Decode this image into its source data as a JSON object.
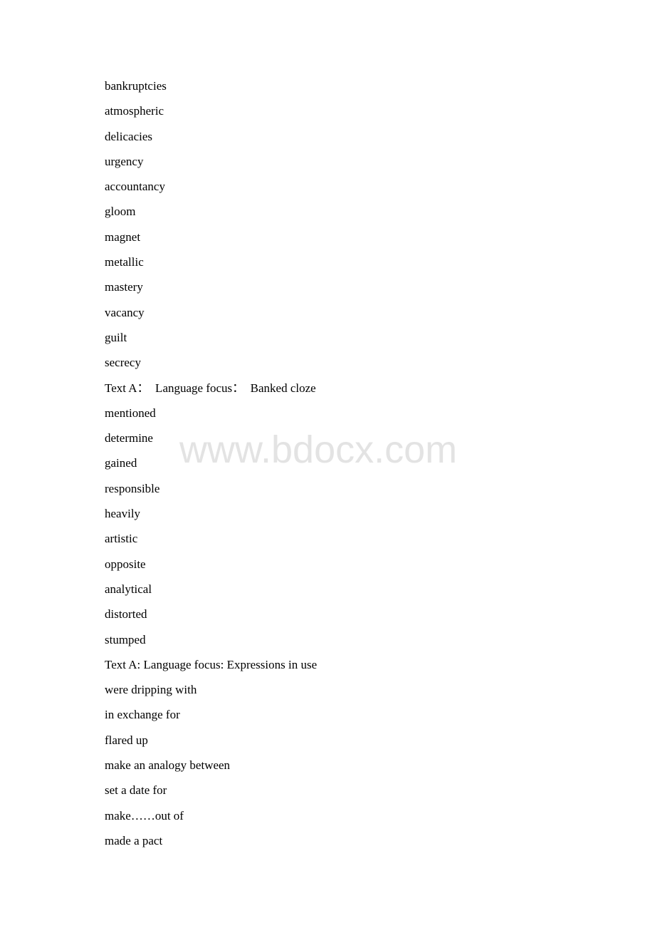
{
  "document": {
    "vocabulary_words": [
      "bankruptcies",
      "atmospheric",
      "delicacies",
      "urgency",
      "accountancy",
      "gloom",
      "magnet",
      "metallic",
      "mastery",
      "vacancy",
      "guilt",
      "secrecy"
    ],
    "banked_cloze_heading": "Text A：  Language focus：  Banked cloze",
    "banked_cloze_answers": [
      "mentioned",
      "determine",
      "gained",
      "responsible",
      "heavily",
      "artistic",
      "opposite",
      "analytical",
      "distorted",
      "stumped"
    ],
    "expressions_heading": "Text A: Language focus: Expressions in use",
    "expressions_answers": [
      "were dripping with",
      "in exchange for",
      "flared up",
      "make an analogy between",
      "set a date for",
      "make……out of",
      "made a pact"
    ]
  },
  "watermark": {
    "text": "www.bdocx.com",
    "color": "#e3e3e3"
  }
}
